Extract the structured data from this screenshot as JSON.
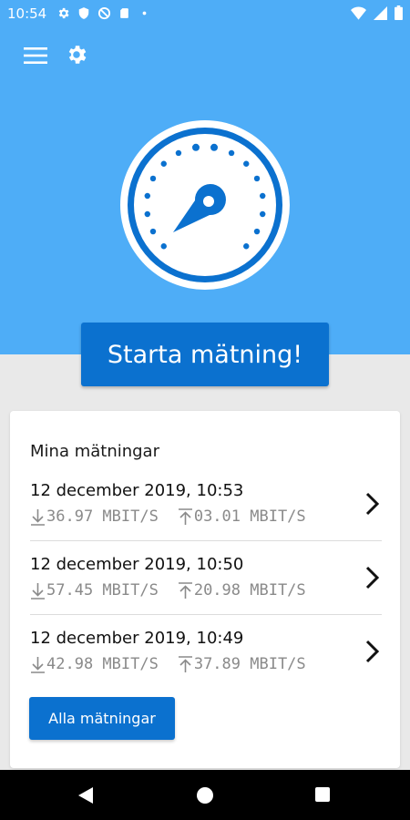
{
  "status": {
    "time": "10:54"
  },
  "colors": {
    "hero": "#4eadf7",
    "primary": "#0b71cf",
    "background": "#e9e9e9"
  },
  "header": {
    "menu_icon": "hamburger-menu-icon",
    "settings_icon": "gear-icon"
  },
  "gauge": {
    "icon": "speedometer-gauge-icon"
  },
  "start_button": {
    "label": "Starta mätning!"
  },
  "measurements": {
    "title": "Mina mätningar",
    "items": [
      {
        "date": "12 december 2019, 10:53",
        "download": "36.97 MBIT/S",
        "upload": "03.01 MBIT/S"
      },
      {
        "date": "12 december 2019, 10:50",
        "download": "57.45 MBIT/S",
        "upload": "20.98 MBIT/S"
      },
      {
        "date": "12 december 2019, 10:49",
        "download": "42.98 MBIT/S",
        "upload": "37.89 MBIT/S"
      }
    ],
    "all_button": "Alla mätningar"
  },
  "nav": {
    "back_icon": "back-triangle-icon",
    "home_icon": "home-circle-icon",
    "recents_icon": "recents-square-icon"
  }
}
